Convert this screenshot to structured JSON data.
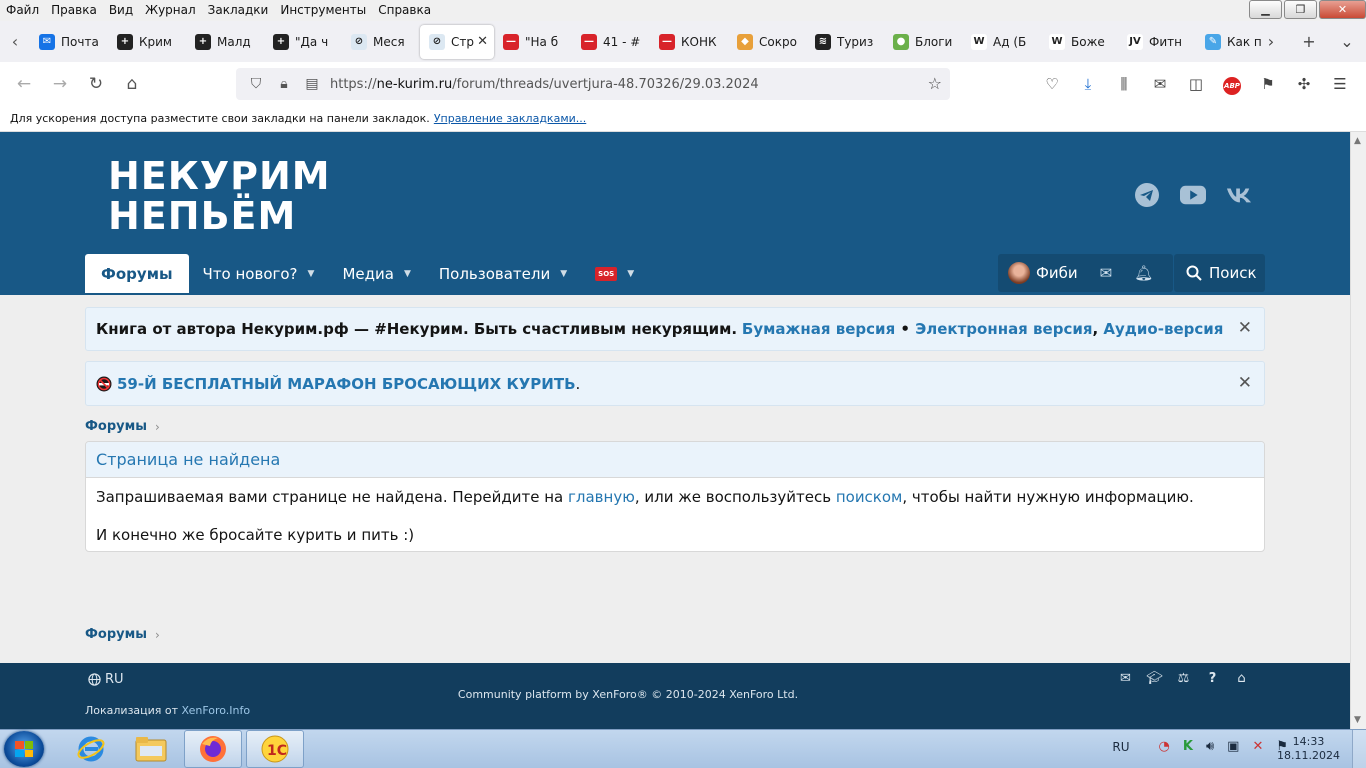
{
  "menubar": [
    "Файл",
    "Правка",
    "Вид",
    "Журнал",
    "Закладки",
    "Инструменты",
    "Справка"
  ],
  "tabs": [
    {
      "label": "Почта",
      "fav_color": "#1673e6",
      "fav_icon": "mail-icon",
      "glyph": "✉"
    },
    {
      "label": "Крим",
      "fav_color": "#222222",
      "fav_icon": "plus-icon",
      "glyph": "+"
    },
    {
      "label": "Малд",
      "fav_color": "#222222",
      "fav_icon": "plus-icon",
      "glyph": "+"
    },
    {
      "label": "\"Да ч",
      "fav_color": "#222222",
      "fav_icon": "plus-icon",
      "glyph": "+"
    },
    {
      "label": "Меся",
      "fav_color": "#dce8f2",
      "fav_icon": "no-smoking-icon",
      "glyph": "⊘"
    },
    {
      "label": "Стр",
      "fav_color": "#dce8f2",
      "fav_icon": "no-smoking-icon",
      "glyph": "⊘",
      "active": true
    },
    {
      "label": "\"На б",
      "fav_color": "#d8232a",
      "fav_icon": "no-entry-icon",
      "glyph": "—"
    },
    {
      "label": "41 - #",
      "fav_color": "#d8232a",
      "fav_icon": "no-entry-icon",
      "glyph": "—"
    },
    {
      "label": "КОНК",
      "fav_color": "#d8232a",
      "fav_icon": "no-entry-icon",
      "glyph": "—"
    },
    {
      "label": "Сокро",
      "fav_color": "#e8a03a",
      "fav_icon": "gem-icon",
      "glyph": "◆"
    },
    {
      "label": "Туриз",
      "fav_color": "#222222",
      "fav_icon": "stack-icon",
      "glyph": "≋"
    },
    {
      "label": "Блоги",
      "fav_color": "#6bb04a",
      "fav_icon": "globe-icon",
      "glyph": "●"
    },
    {
      "label": "Ад (Б",
      "fav_color": "#ffffff",
      "fav_icon": "wikipedia-icon",
      "glyph": "W"
    },
    {
      "label": "Боже",
      "fav_color": "#ffffff",
      "fav_icon": "wikipedia-icon",
      "glyph": "W"
    },
    {
      "label": "Фитн",
      "fav_color": "#ffffff",
      "fav_icon": "jv-icon",
      "glyph": "JV"
    },
    {
      "label": "Как п",
      "fav_color": "#49a6e8",
      "fav_icon": "edit-icon",
      "glyph": "✎"
    }
  ],
  "address": {
    "domain": "ne-kurim.ru",
    "path": "/forum/threads/uvertjura-48.70326/29.03.2024",
    "scheme": "https://"
  },
  "bookmarks": {
    "hint": "Для ускорения доступа разместите свои закладки на панели закладок.",
    "manage_link": "Управление закладками..."
  },
  "site": {
    "logo_line1": "НЕКУРИМ",
    "logo_line2": "НЕПЬЁМ",
    "nav": [
      {
        "label": "Форумы",
        "selected": true
      },
      {
        "label": "Что нового?"
      },
      {
        "label": "Медиа"
      },
      {
        "label": "Пользователи"
      }
    ],
    "sos_label": "SOS",
    "user_name": "Фиби",
    "search_label": "Поиск"
  },
  "notices": {
    "book_prefix": "Книга от автора Некурим.рф — #Некурим. Быть счастливым некурящим.",
    "paper": "Бумажная версия",
    "bullet": " • ",
    "ebook": "Электронная версия",
    "comma": ", ",
    "audio": "Аудио-версия",
    "marathon": "59-Й БЕСПЛАТНЫЙ МАРАФОН БРОСАЮЩИХ КУРИТЬ",
    "marathon_dot": ".",
    "close_glyph": "✕"
  },
  "breadcrumb": {
    "label": "Форумы",
    "chevron": "›"
  },
  "error_block": {
    "title": "Страница не найдена",
    "text_1": "Запрашиваемая вами странице не найдена. Перейдите на ",
    "link_home": "главную",
    "text_2": ", или же воспользуйтесь ",
    "link_search": "поиском",
    "text_3": ", чтобы найти нужную информацию.",
    "line_2": "И конечно же бросайте курить и пить :)"
  },
  "footer": {
    "lang": "RU",
    "copyright": "Community platform by XenForo® © 2010-2024 XenForo Ltd.",
    "loc_prefix": "Локализация от ",
    "loc_link": "XenForo.Info"
  },
  "taskbar": {
    "lang": "RU",
    "time": "14:33",
    "date": "18.11.2024"
  },
  "colors": {
    "header": "#185886",
    "accent_link": "#2577b1",
    "footer": "#123d5d",
    "page_bg": "#eeeeee"
  }
}
